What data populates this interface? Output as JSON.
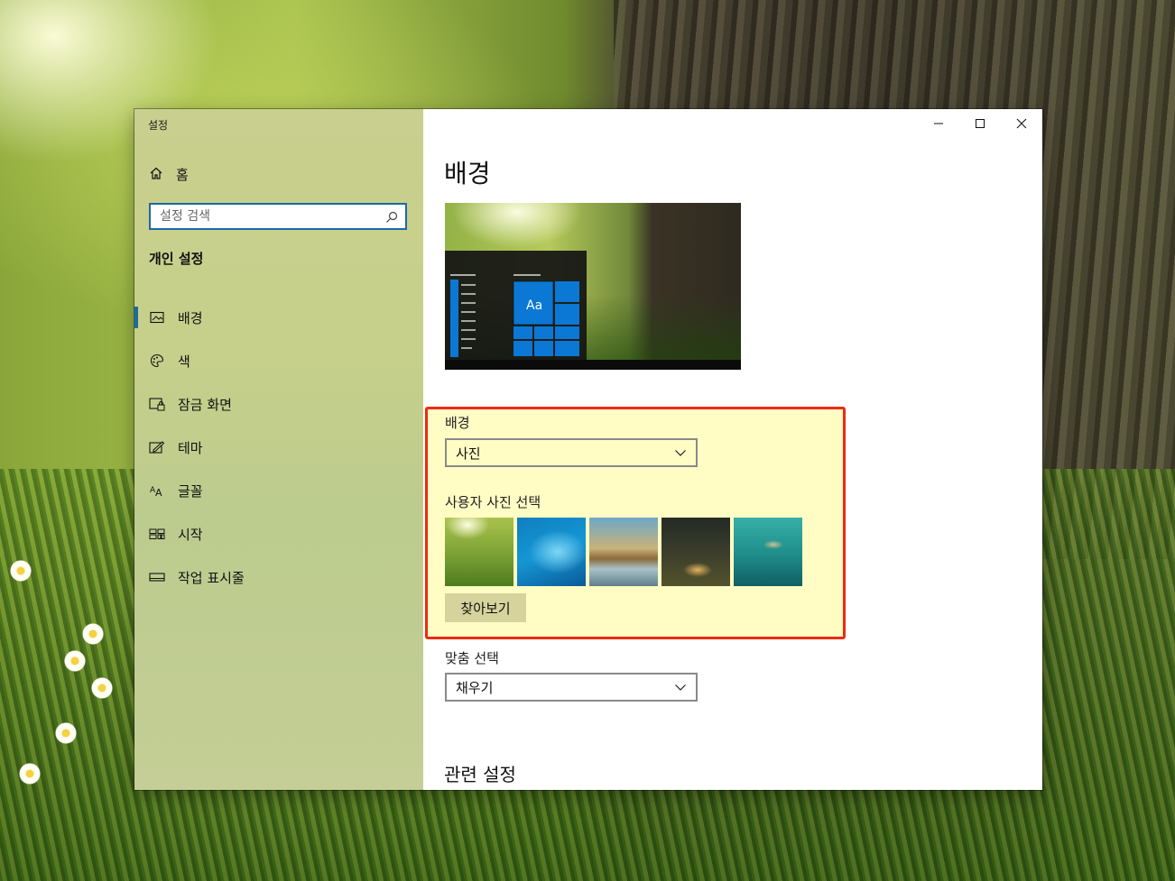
{
  "window": {
    "title": "설정",
    "controls": {
      "minimize": "minimize-icon",
      "maximize": "maximize-icon",
      "close": "close-icon"
    }
  },
  "sidebar": {
    "home_label": "홈",
    "search_placeholder": "설정 검색",
    "section_title": "개인 설정",
    "items": [
      {
        "label": "배경",
        "icon": "picture-icon",
        "active": true
      },
      {
        "label": "색",
        "icon": "palette-icon",
        "active": false
      },
      {
        "label": "잠금 화면",
        "icon": "lock-screen-icon",
        "active": false
      },
      {
        "label": "테마",
        "icon": "theme-icon",
        "active": false
      },
      {
        "label": "글꼴",
        "icon": "font-icon",
        "active": false
      },
      {
        "label": "시작",
        "icon": "start-icon",
        "active": false
      },
      {
        "label": "작업 표시줄",
        "icon": "taskbar-icon",
        "active": false
      }
    ]
  },
  "main": {
    "title": "배경",
    "preview": {
      "tile_text": "Aa"
    },
    "background": {
      "label": "배경",
      "value": "사진"
    },
    "choose_picture": {
      "label": "사용자 사진 선택",
      "browse_label": "찾아보기"
    },
    "fit": {
      "label": "맞춤 선택",
      "value": "채우기"
    },
    "related_title": "관련 설정"
  },
  "colors": {
    "accent": "#1b6aa5",
    "highlight_border": "#ee2a12",
    "highlight_fill": "#fffcc4",
    "tile_blue": "#0a78d4"
  }
}
